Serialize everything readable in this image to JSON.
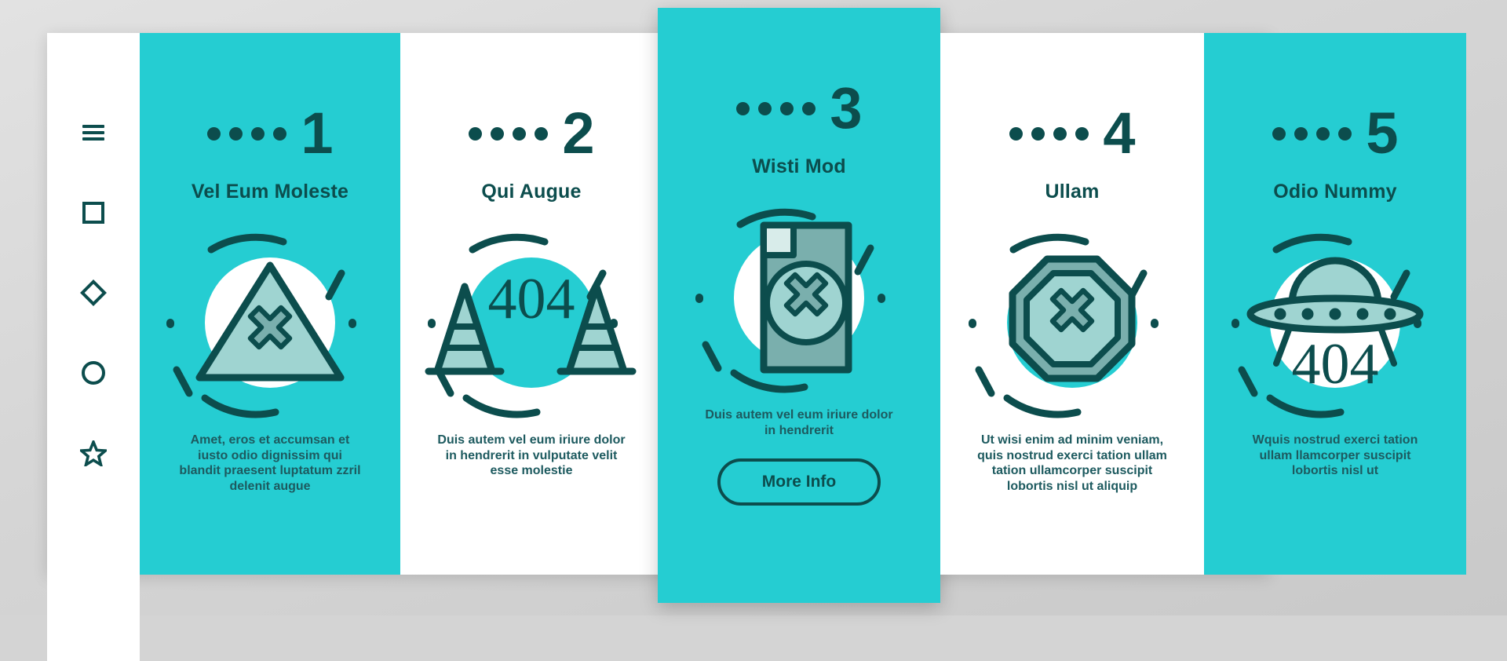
{
  "colors": {
    "teal": "#25cdd2",
    "dark_teal": "#0c4d4d",
    "body_text": "#1d5a5f",
    "white": "#ffffff",
    "backdrop": "#d4d4d4",
    "art_fill_light": "#9fd4d1",
    "art_fill_mid": "#7aafad"
  },
  "sidebar": {
    "items": [
      {
        "icon": "hamburger-menu-icon",
        "label": "Menu"
      },
      {
        "icon": "square-icon",
        "label": "Square"
      },
      {
        "icon": "diamond-icon",
        "label": "Diamond"
      },
      {
        "icon": "circle-icon",
        "label": "Circle"
      },
      {
        "icon": "star-icon",
        "label": "Star"
      }
    ]
  },
  "panels": [
    {
      "step": "1",
      "dots": 4,
      "title": "Vel Eum Moleste",
      "body": "Amet, eros et accumsan et iusto odio dignissim qui blandit praesent luptatum zzril delenit augue",
      "illustration": "warning-triangle-cross-icon",
      "theme": "teal",
      "featured": false,
      "button": null
    },
    {
      "step": "2",
      "dots": 4,
      "title": "Qui Augue",
      "body": "Duis autem vel eum iriure dolor in hendrerit in vulputate velit esse molestie",
      "illustration": "traffic-cones-404-icon",
      "badge": "404",
      "theme": "white",
      "featured": false,
      "button": null
    },
    {
      "step": "3",
      "dots": 4,
      "title": "Wisti Mod",
      "body": "Duis autem vel eum iriure dolor in hendrerit",
      "illustration": "document-error-cross-icon",
      "theme": "teal",
      "featured": true,
      "button": "More Info"
    },
    {
      "step": "4",
      "dots": 4,
      "title": "Ullam",
      "body": "Ut wisi enim ad minim veniam, quis nostrud exerci tation ullam tation ullamcorper suscipit lobortis nisl ut aliquip",
      "illustration": "octagon-stop-cross-icon",
      "theme": "white",
      "featured": false,
      "button": null
    },
    {
      "step": "5",
      "dots": 4,
      "title": "Odio Nummy",
      "body": "Wquis nostrud exerci tation ullam llamcorper suscipit lobortis nisl ut",
      "illustration": "ufo-404-icon",
      "badge": "404",
      "theme": "teal",
      "featured": false,
      "button": null
    }
  ]
}
